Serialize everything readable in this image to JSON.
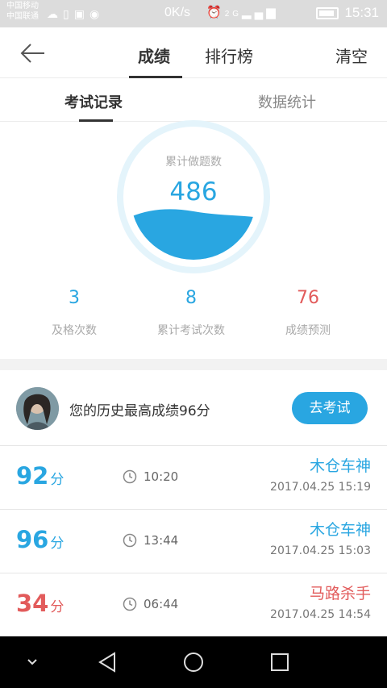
{
  "status_bar": {
    "carrier_1": "中国移动",
    "carrier_2": "中国联通",
    "speed": "0K/s",
    "network": "2G",
    "time": "15:31"
  },
  "header": {
    "tabs": [
      {
        "label": "成绩",
        "active": true
      },
      {
        "label": "排行榜",
        "active": false
      }
    ],
    "clear_label": "清空"
  },
  "sub_tabs": [
    {
      "label": "考试记录",
      "active": true
    },
    {
      "label": "数据统计",
      "active": false
    }
  ],
  "summary": {
    "label": "累计做题数",
    "value": "486"
  },
  "stats": [
    {
      "value": "3",
      "label": "及格次数",
      "color": "#29a6e1"
    },
    {
      "value": "8",
      "label": "累计考试次数",
      "color": "#29a6e1"
    },
    {
      "value": "76",
      "label": "成绩预测",
      "color": "#e25b5b"
    }
  ],
  "best": {
    "text": "您的历史最高成绩96分",
    "button_label": "去考试"
  },
  "records": [
    {
      "score": "92",
      "unit": "分",
      "duration": "10:20",
      "name": "木仓车神",
      "datetime": "2017.04.25  15:19",
      "color": "blue"
    },
    {
      "score": "96",
      "unit": "分",
      "duration": "13:44",
      "name": "木仓车神",
      "datetime": "2017.04.25  15:03",
      "color": "blue"
    },
    {
      "score": "34",
      "unit": "分",
      "duration": "06:44",
      "name": "马路杀手",
      "datetime": "2017.04.25  14:54",
      "color": "red"
    }
  ],
  "colors": {
    "accent": "#29a6e1",
    "warning": "#e25b5b"
  }
}
